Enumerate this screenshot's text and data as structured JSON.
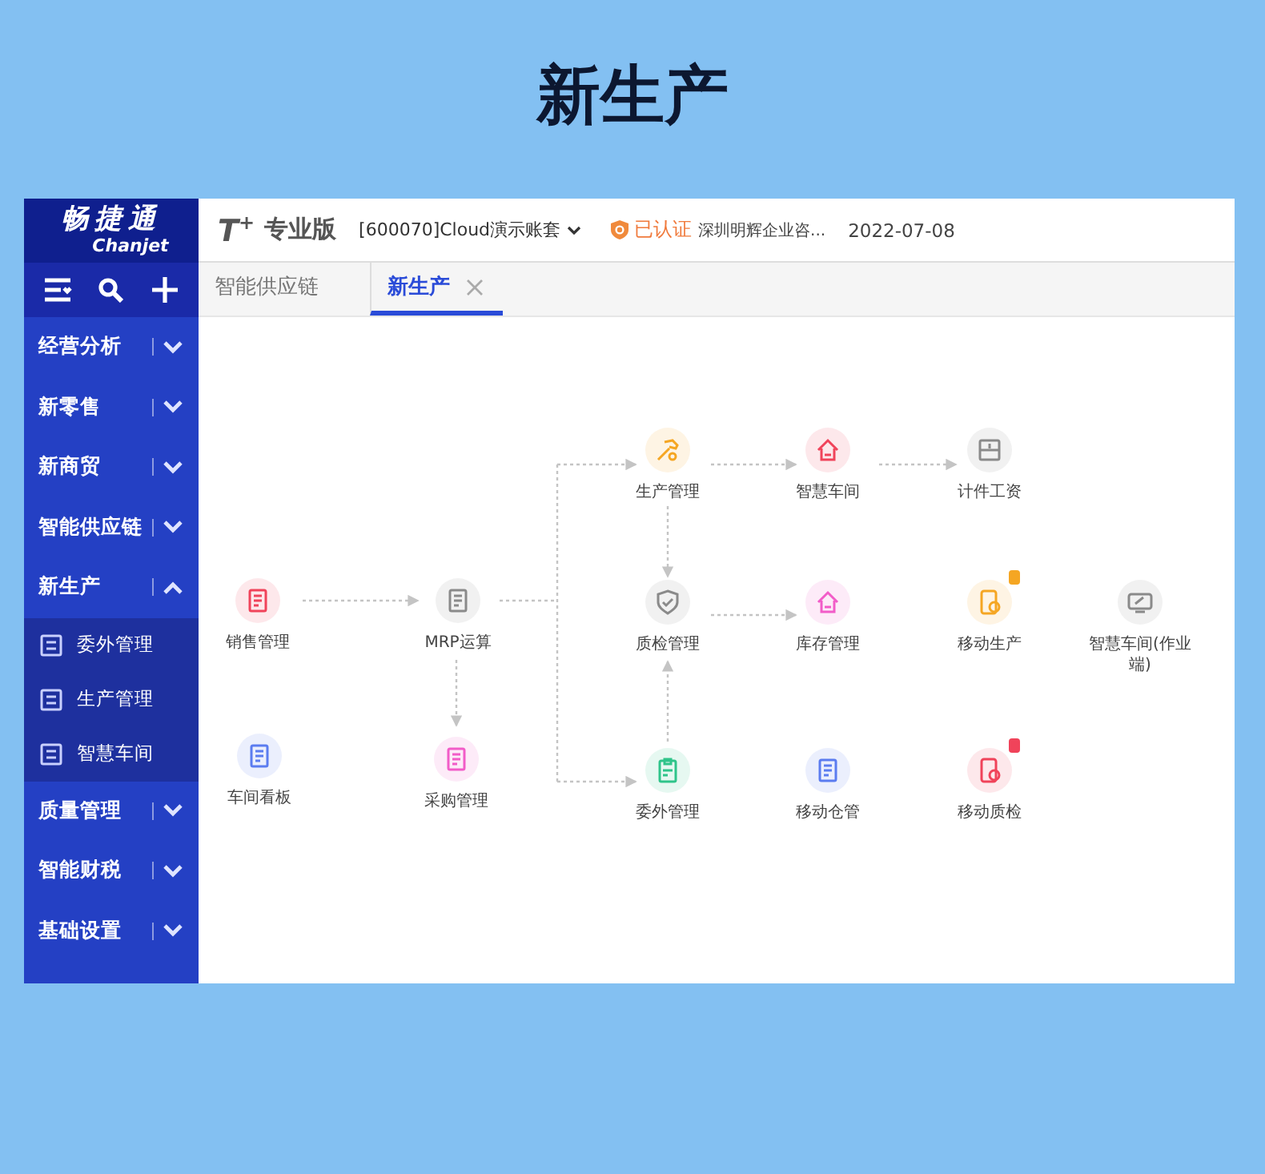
{
  "page_title": "新生产",
  "sidebar": {
    "logo": {
      "name": "畅捷通",
      "latin": "Chanjet"
    },
    "menu": [
      {
        "label": "经营分析",
        "expanded": false
      },
      {
        "label": "新零售",
        "expanded": false
      },
      {
        "label": "新商贸",
        "expanded": false
      },
      {
        "label": "智能供应链",
        "expanded": false
      },
      {
        "label": "新生产",
        "expanded": true,
        "children": [
          {
            "label": "委外管理"
          },
          {
            "label": "生产管理"
          },
          {
            "label": "智慧车间"
          }
        ]
      },
      {
        "label": "质量管理",
        "expanded": false
      },
      {
        "label": "智能财税",
        "expanded": false
      },
      {
        "label": "基础设置",
        "expanded": false
      }
    ]
  },
  "header": {
    "product": "T",
    "product_mark": "+",
    "edition": "专业版",
    "account": "[600070]Cloud演示账套",
    "verified": "已认证",
    "company": "深圳明辉企业咨...",
    "date": "2022-07-08"
  },
  "tabs": [
    {
      "label": "智能供应链",
      "selected": false,
      "closable": false
    },
    {
      "label": "新生产",
      "selected": true,
      "closable": true
    }
  ],
  "flow": {
    "nodes": [
      {
        "label": "生产管理",
        "color": "#f5a623"
      },
      {
        "label": "智慧车间",
        "color": "#f0435a"
      },
      {
        "label": "计件工资",
        "color": "#8a8a8a"
      },
      {
        "label": "销售管理",
        "color": "#f0435a"
      },
      {
        "label": "MRP运算",
        "color": "#8a8a8a"
      },
      {
        "label": "质检管理",
        "color": "#8a8a8a"
      },
      {
        "label": "库存管理",
        "color": "#f25cc8"
      },
      {
        "label": "移动生产",
        "color": "#f5a623",
        "badge": {
          "color": "#f5a623"
        }
      },
      {
        "label": "智慧车间(作业端)",
        "color": "#8a8a8a"
      },
      {
        "label": "车间看板",
        "color": "#5b7cf0"
      },
      {
        "label": "采购管理",
        "color": "#f25cc8"
      },
      {
        "label": "委外管理",
        "color": "#2fc48a"
      },
      {
        "label": "移动仓管",
        "color": "#5b7cf0"
      },
      {
        "label": "移动质检",
        "color": "#f0435a",
        "badge": {
          "color": "#f0435a"
        }
      }
    ]
  }
}
